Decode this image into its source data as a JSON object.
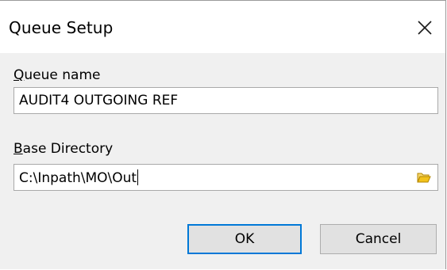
{
  "window": {
    "title": "Queue Setup",
    "close_icon": "close-icon"
  },
  "form": {
    "queue_name_label_mnemonic": "Q",
    "queue_name_label_rest": "ueue name",
    "queue_name_value": "AUDIT4 OUTGOING REF",
    "base_directory_label_mnemonic": "B",
    "base_directory_label_rest": "ase Directory",
    "base_directory_value": "C:\\Inpath\\MO\\Out",
    "browse_icon": "folder-icon"
  },
  "buttons": {
    "ok_label": "OK",
    "cancel_label": "Cancel"
  },
  "colors": {
    "accent": "#0078d7",
    "folder_icon": "#e8b400"
  }
}
